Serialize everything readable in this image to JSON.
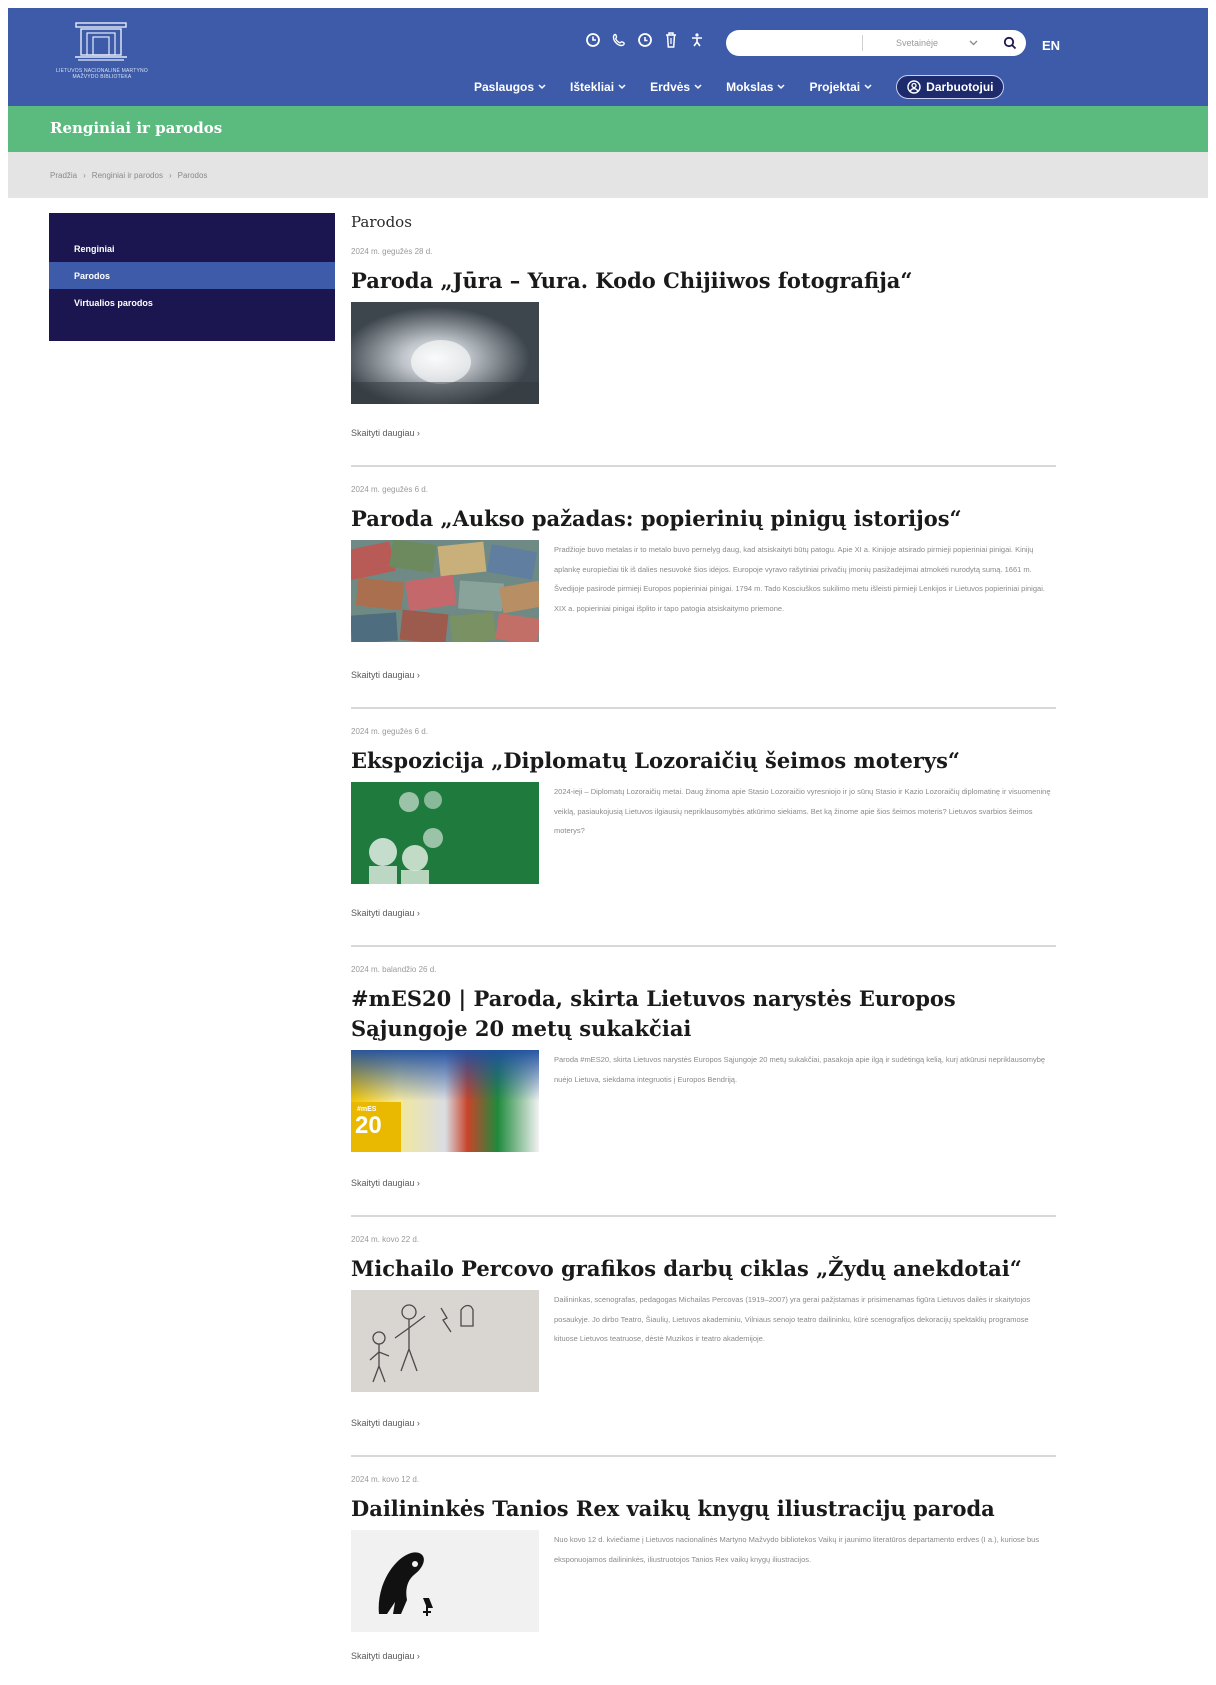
{
  "header": {
    "logo_text": "LIETUVOS NACIONALINĖ MARTYNO MAŽVYDO BIBLIOTEKA",
    "utility_icons": [
      "clock-icon",
      "phone-icon",
      "clock-icon",
      "trash-icon",
      "accessibility-icon"
    ],
    "search": {
      "placeholder": "",
      "select_value": "Svetainėje"
    },
    "lang": "EN",
    "nav": [
      {
        "label": "Paslaugos"
      },
      {
        "label": "Ištekliai"
      },
      {
        "label": "Erdvės"
      },
      {
        "label": "Mokslas"
      },
      {
        "label": "Projektai"
      }
    ],
    "staff_label": "Darbuotojui"
  },
  "title_band": "Renginiai ir parodos",
  "breadcrumb": [
    "Pradžia",
    "Renginiai ir parodos",
    "Parodos"
  ],
  "sidebar": {
    "items": [
      {
        "label": "Renginiai"
      },
      {
        "label": "Parodos"
      },
      {
        "label": "Virtualios parodos"
      }
    ]
  },
  "content": {
    "heading": "Parodos",
    "read_more": "Skaityti daugiau",
    "articles": [
      {
        "date": "2024 m. gegužės 28 d.",
        "title": "Paroda „Jūra – Yura. Kodo Chijiiwos fotografija“",
        "excerpt": ""
      },
      {
        "date": "2024 m. gegužės 6 d.",
        "title": "Paroda „Aukso pažadas: popierinių pinigų istorijos“",
        "excerpt": "Pradžioje buvo metalas ir to metalo buvo pernelyg daug, kad atsiskaityti būtų patogu. Apie XI a. Kinijoje atsirado pirmieji popieriniai pinigai. Kinijų aplankę europiečiai tik iš dalies nesuvokė šios idėjos. Europoje vyravo rašytiniai privačių įmonių pasižadėjimai atmokėti nurodytą sumą. 1661 m. Švedijoje pasirodė pirmieji Europos popieriniai pinigai. 1794 m. Tado Kosciuškos sukilimo metu išleisti pirmieji Lenkijos ir Lietuvos popieriniai pinigai. XIX a. popieriniai pinigai išplito ir tapo patogia atsiskaitymo priemone."
      },
      {
        "date": "2024 m. gegužės 6 d.",
        "title": "Ekspozicija „Diplomatų Lozoraičių šeimos moterys“",
        "excerpt": "2024-ieji – Diplomatų Lozoraičių metai. Daug žinoma apie Stasio Lozoraičio vyresniojo ir jo sūnų Stasio ir Kazio Lozoraičių diplomatinę ir visuomeninę veiklą, pasiaukojusią Lietuvos ilgiausių nepriklausomybės atkūrimo siekiams. Bet ką žinome apie šios šeimos moteris? Lietuvos svarbios šeimos moterys?"
      },
      {
        "date": "2024 m. balandžio 26 d.",
        "title": "#mES20 | Paroda, skirta Lietuvos narystės Europos Sąjungoje 20 metų sukakčiai",
        "excerpt": "Paroda #mES20, skirta Lietuvos narystės Europos Sąjungoje 20 metų sukakčiai, pasakoja apie ilgą ir sudėtingą kelią, kurį atkūrusi nepriklausomybę nuėjo Lietuva, siekdama integruotis į Europos Bendriją.",
        "thumb_badge_top": "#mES",
        "thumb_badge_num": "20"
      },
      {
        "date": "2024 m. kovo 22 d.",
        "title": "Michailo Percovo grafikos darbų ciklas „Žydų anekdotai“",
        "excerpt": "Dailininkas, scenografas, pedagogas Michailas Percovas (1919–2007) yra gerai pažįstamas ir prisimenamas figūra Lietuvos dailės ir skaitytojos posaukyje. Jo dirbo Teatro, Šiaulių, Lietuvos akademiniu, Vilniaus senojo teatro dailininku, kūrė scenografijos dekoracijų spektaklių programose kituose Lietuvos teatruose, dėstė Muzikos ir teatro akademijoje."
      },
      {
        "date": "2024 m. kovo 12 d.",
        "title": "Dailininkės Tanios Rex vaikų knygų iliustracijų paroda",
        "excerpt": "Nuo kovo 12 d. kviečiame į Lietuvos nacionalinės Martyno Mažvydo bibliotekos Vaikų ir jaunimo literatūros departamento erdves (I a.), kuriose bus eksponuojamos dailininkės, iliustruotojos Tanios Rex vaikų knygų iliustracijos."
      }
    ]
  },
  "colors": {
    "header_bg": "#3d5ba8",
    "title_band_bg": "#5bbb7e",
    "sidebar_bg": "#1c1650",
    "sidebar_active_bg": "#3d5ba8",
    "breadcrumb_bg": "#e4e4e4"
  }
}
